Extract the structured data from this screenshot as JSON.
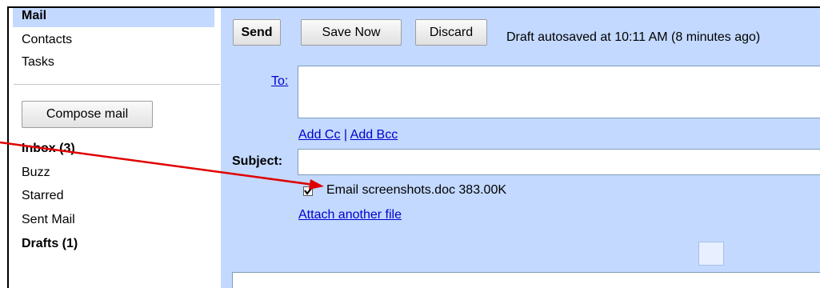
{
  "nav": {
    "mail": "Mail",
    "contacts": "Contacts",
    "tasks": "Tasks"
  },
  "compose_button": "Compose mail",
  "folders": {
    "inbox": "Inbox (3)",
    "buzz": "Buzz",
    "starred": "Starred",
    "sent": "Sent Mail",
    "drafts": "Drafts (1)"
  },
  "toolbar": {
    "send": "Send",
    "save_now": "Save Now",
    "discard": "Discard",
    "autosave": "Draft autosaved at 10:11 AM (8 minutes ago)"
  },
  "form": {
    "to_label": "To:",
    "to_value": "",
    "add_cc": "Add Cc",
    "separator": "|",
    "add_bcc": "Add Bcc",
    "subject_label": "Subject:",
    "subject_value": "",
    "attachment": {
      "checked": true,
      "filename": "Email screenshots.doc 383.00K"
    },
    "attach_another": "Attach another file"
  },
  "colors": {
    "panel_bg": "#c3d9ff",
    "link": "#0000cc",
    "annotation_arrow": "#e00000"
  }
}
